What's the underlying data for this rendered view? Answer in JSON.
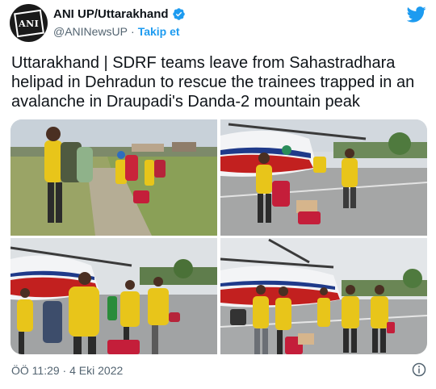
{
  "author": {
    "name": "ANI UP/Uttarakhand",
    "handle": "@ANINewsUP",
    "follow_label": "Takip et",
    "avatar_text": "ANI"
  },
  "tweet": {
    "text": "Uttarakhand | SDRF teams leave from Sahastradhara helipad in Dehradun to rescue the trainees trapped in an avalanche in Draupadi's Danda-2 mountain peak"
  },
  "photos": [
    {
      "icon": "photo-sdrf-team-field"
    },
    {
      "icon": "photo-helicopter-loading"
    },
    {
      "icon": "photo-team-near-helicopter"
    },
    {
      "icon": "photo-team-helipad"
    }
  ],
  "footer": {
    "timestamp": "ÖÖ 11:29 · 4 Eki 2022"
  },
  "colors": {
    "accent": "#1d9bf0",
    "text_primary": "#0f1419",
    "text_secondary": "#536471"
  }
}
